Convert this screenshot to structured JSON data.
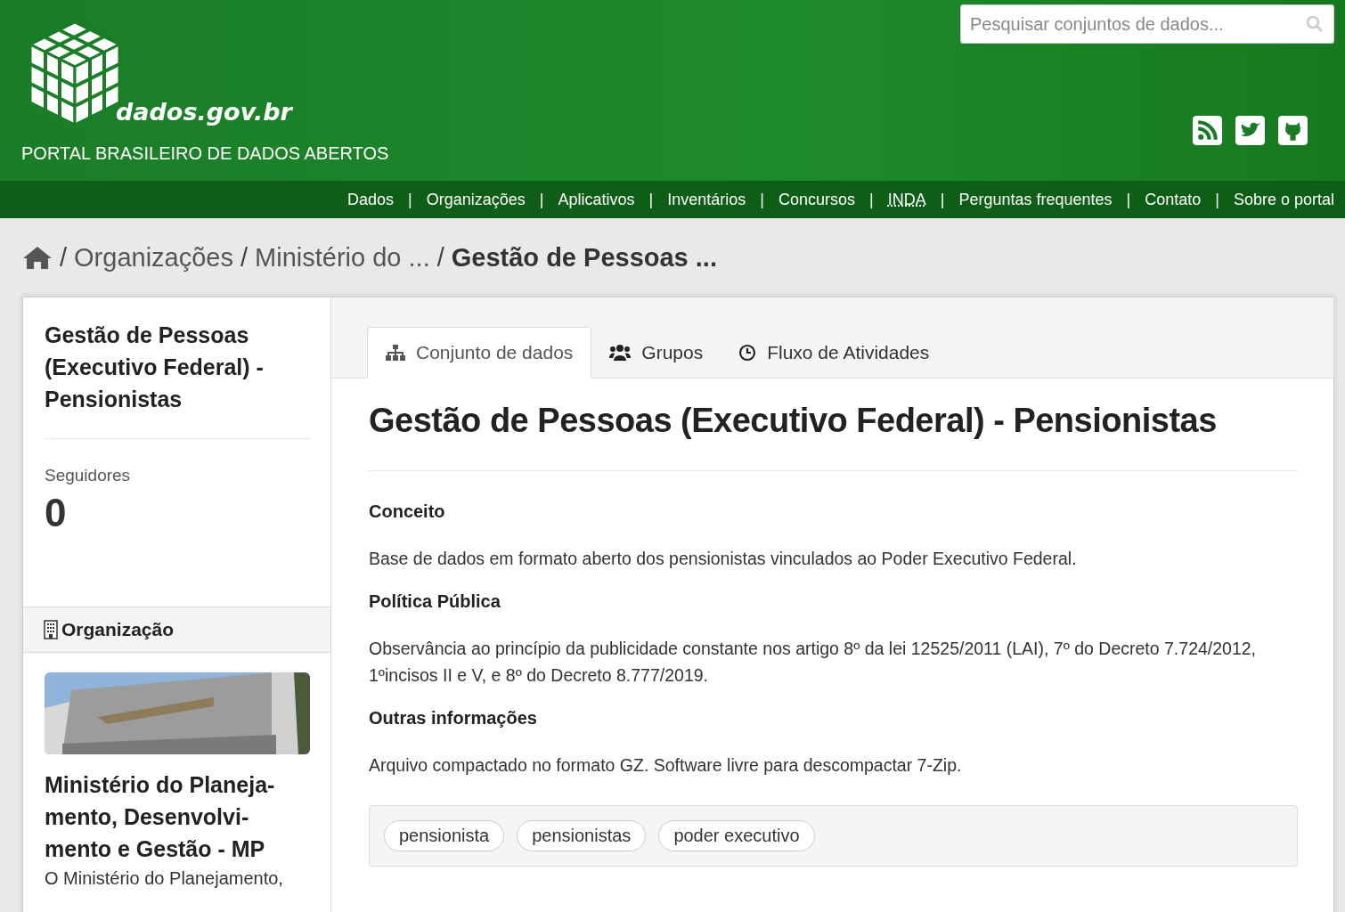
{
  "header": {
    "logo_text": "dados.gov.br",
    "tagline": "PORTAL BRASILEIRO DE DADOS ABERTOS",
    "search": {
      "placeholder": "Pesquisar conjuntos de dados..."
    },
    "social": [
      {
        "kind": "rss"
      },
      {
        "kind": "twitter"
      },
      {
        "kind": "github"
      }
    ]
  },
  "nav_separator": "|",
  "breadcrumb_separator": "/",
  "nav": [
    {
      "label": "Dados",
      "kind": "link"
    },
    {
      "label": "Organizações",
      "kind": "link"
    },
    {
      "label": "Aplicativos",
      "kind": "link"
    },
    {
      "label": "Inventários",
      "kind": "link"
    },
    {
      "label": "Concursos",
      "kind": "link"
    },
    {
      "label": "INDA",
      "kind": "abbr"
    },
    {
      "label": "Perguntas frequentes",
      "kind": "link"
    },
    {
      "label": "Contato",
      "kind": "link"
    },
    {
      "label": "Sobre o portal",
      "kind": "link"
    }
  ],
  "breadcrumb": [
    {
      "label": "Organizações",
      "current": false
    },
    {
      "label": "Ministério do ...",
      "current": false
    },
    {
      "label": "Gestão de Pessoas ...",
      "current": true
    }
  ],
  "sidebar": {
    "title": "Gestão de Pessoas (Executivo Federal) - Pensionistas",
    "followers_label": "Seguidores",
    "followers_count": "0",
    "org_heading": "Organização",
    "org_name": "Ministério do Planeja-mento, Desenvolvi-mento e Gestão - MP",
    "org_description": "O Ministério do Planejamento,"
  },
  "tabs": [
    {
      "label": "Conjunto de dados",
      "kind": "datasets",
      "selected": true
    },
    {
      "label": "Grupos",
      "kind": "groups",
      "selected": false
    },
    {
      "label": "Fluxo de Atividades",
      "kind": "activity",
      "selected": false
    }
  ],
  "content": {
    "title": "Gestão de Pessoas (Executivo Federal) - Pensionistas",
    "sections": [
      {
        "heading": "Conceito",
        "text": "Base de dados em formato aberto dos pensionistas vinculados ao Poder Executivo Federal."
      },
      {
        "heading": "Política Pública",
        "text": "Observância ao princípio da publicidade constante nos artigo 8º da lei 12525/2011 (LAI), 7º do Decreto 7.724/2012, 1ºincisos II e V, e 8º do Decreto 8.777/2019."
      },
      {
        "heading": "Outras informações",
        "text": "Arquivo compactado no formato GZ. Software livre para descompactar 7-Zip."
      }
    ],
    "tags": [
      "pensionista",
      "pensionistas",
      "poder executivo"
    ]
  }
}
